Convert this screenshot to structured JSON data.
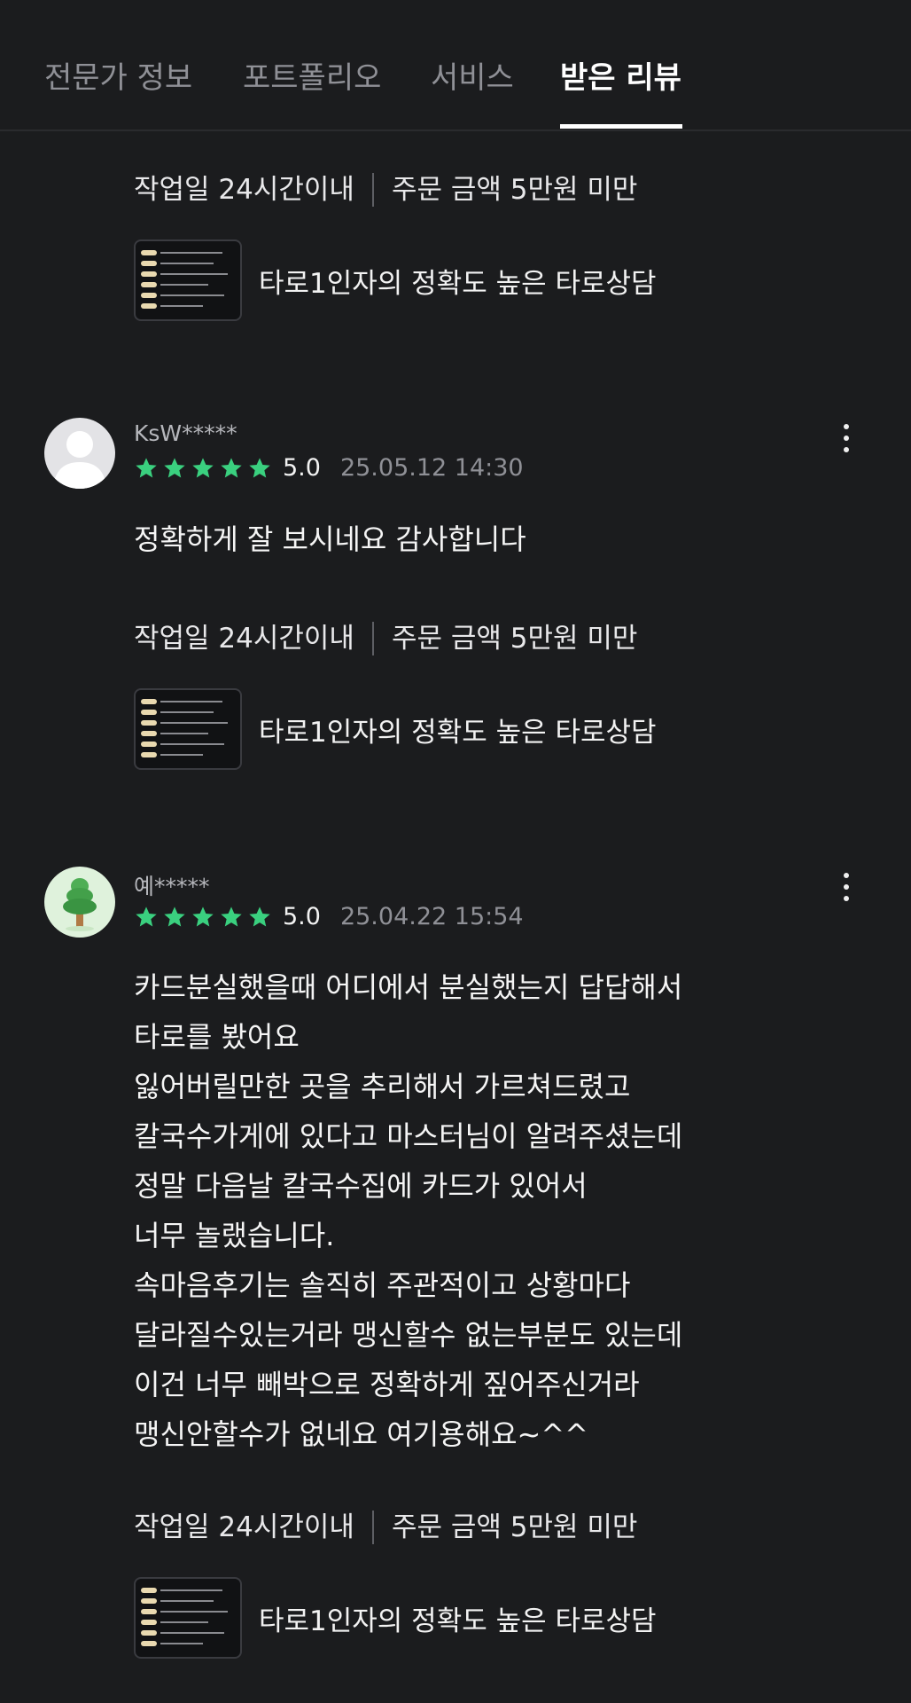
{
  "tabs": [
    "전문가 정보",
    "포트폴리오",
    "서비스",
    "받은 리뷰"
  ],
  "active_tab": "받은 리뷰",
  "colors": {
    "star": "#3ad07f",
    "background": "#1b1c1e"
  },
  "meta": {
    "work_days": "작업일 24시간이내",
    "order_amount": "주문 금액 5만원 미만"
  },
  "service_title": "타로1인자의 정확도 높은 타로상담",
  "reviews": [
    {
      "username": "KsW*****",
      "avatar_icon": "default-user-icon",
      "score": "5.0",
      "date": "25.05.12 14:30",
      "stars": 5,
      "text": "정확하게 잘 보시네요 감사합니다"
    },
    {
      "username": "예*****",
      "avatar_icon": "tree-icon",
      "score": "5.0",
      "date": "25.04.22 15:54",
      "stars": 5,
      "text": "카드분실했을때 어디에서 분실했는지 답답해서\n타로를 봤어요\n잃어버릴만한 곳을 추리해서 가르쳐드렸고\n칼국수가게에 있다고 마스터님이 알려주셨는데\n정말 다음날 칼국수집에 카드가 있어서\n너무 놀랬습니다.\n속마음후기는 솔직히 주관적이고 상황마다\n달라질수있는거라 맹신할수 없는부분도 있는데\n이건 너무 빼박으로 정확하게 짚어주신거라\n맹신안할수가 없네요 여기용해요~^^"
    }
  ]
}
